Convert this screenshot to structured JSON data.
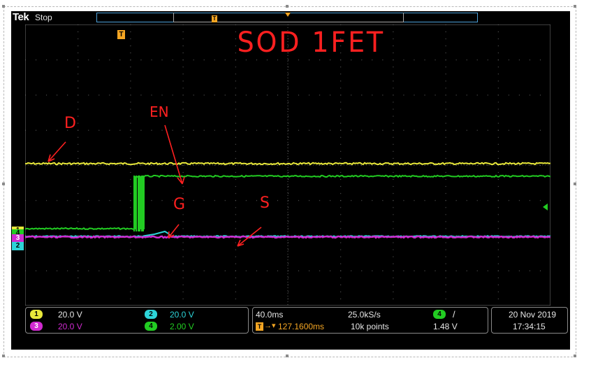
{
  "scope": {
    "brand": "Tek",
    "run_state": "Stop",
    "trigger_marker": "T",
    "trigger_level_marker": "◀"
  },
  "channel_markers": {
    "ch1": "1",
    "ch2": "2",
    "ch3": "3",
    "ch4": "4"
  },
  "annotations": {
    "title": "SOD 1FET",
    "en": "EN",
    "d": "D",
    "g": "G",
    "s": "S"
  },
  "channel_settings": [
    {
      "id": "1",
      "scale": "20.0 V",
      "color": "#e8e83a"
    },
    {
      "id": "2",
      "scale": "20.0 V",
      "color": "#2dd4d8"
    },
    {
      "id": "3",
      "scale": "20.0 V",
      "color": "#d12ad1"
    },
    {
      "id": "4",
      "scale": "2.00 V",
      "color": "#22cc22"
    }
  ],
  "timebase": {
    "time_per_div": "40.0ms",
    "sample_rate": "25.0kS/s",
    "trigger_delay": "127.1600ms",
    "record_length": "10k points",
    "trigger_channel": "4",
    "trigger_slope": "/",
    "trigger_level": "1.48 V"
  },
  "datetime": {
    "date": "20 Nov 2019",
    "time": "17:34:15"
  },
  "colors": {
    "grid": "#7a7a7a",
    "trigger": "#f5a623",
    "annotation": "#ff2020"
  }
}
